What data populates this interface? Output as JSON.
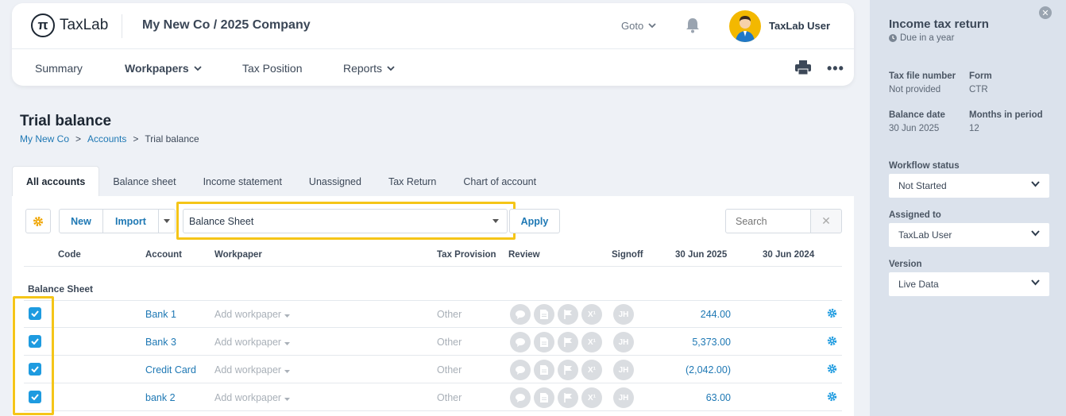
{
  "header": {
    "logo_mark": "π",
    "logo_text": "TaxLab",
    "company": "My New Co / 2025 Company",
    "goto_label": "Goto",
    "username": "TaxLab User"
  },
  "nav": {
    "items": [
      {
        "label": "Summary"
      },
      {
        "label": "Workpapers"
      },
      {
        "label": "Tax Position"
      },
      {
        "label": "Reports"
      }
    ],
    "more_label": "•••"
  },
  "page": {
    "title": "Trial balance",
    "breadcrumb": [
      "My New Co",
      ">",
      "Accounts",
      ">",
      "Trial balance"
    ]
  },
  "tabs": [
    "All accounts",
    "Balance sheet",
    "Income statement",
    "Unassigned",
    "Tax Return",
    "Chart of account"
  ],
  "toolbar": {
    "new_label": "New",
    "import_label": "Import",
    "filter_value": "Balance Sheet",
    "apply_label": "Apply",
    "search_placeholder": "Search",
    "clear_label": "✕"
  },
  "table": {
    "headers": [
      "Code",
      "Account",
      "Workpaper",
      "Tax Provision",
      "Review",
      "Signoff",
      "30 Jun 2025",
      "30 Jun 2024"
    ],
    "group": "Balance Sheet",
    "rows": [
      {
        "account": "Bank 1",
        "workpaper": "Add workpaper",
        "provision": "Other",
        "signoff": "JH",
        "amount": "244.00"
      },
      {
        "account": "Bank 3",
        "workpaper": "Add workpaper",
        "provision": "Other",
        "signoff": "JH",
        "amount": "5,373.00"
      },
      {
        "account": "Credit Card",
        "workpaper": "Add workpaper",
        "provision": "Other",
        "signoff": "JH",
        "amount": "(2,042.00)"
      },
      {
        "account": "bank 2",
        "workpaper": "Add workpaper",
        "provision": "Other",
        "signoff": "JH",
        "amount": "63.00"
      }
    ]
  },
  "sidebar": {
    "close_label": "✕",
    "title": "Income tax return",
    "due": "Due in a year",
    "tax_file_label": "Tax file number",
    "tax_file_value": "Not provided",
    "form_label": "Form",
    "form_value": "CTR",
    "balance_date_label": "Balance date",
    "balance_date_value": "30 Jun 2025",
    "months_label": "Months in period",
    "months_value": "12",
    "workflow_label": "Workflow status",
    "workflow_value": "Not Started",
    "assigned_label": "Assigned to",
    "assigned_value": "TaxLab User",
    "version_label": "Version",
    "version_value": "Live Data"
  },
  "colors": {
    "accent": "#1e78b4",
    "checkbox": "#1e9be0",
    "highlight": "#f5c518",
    "avatar_bg": "#f3b800"
  }
}
